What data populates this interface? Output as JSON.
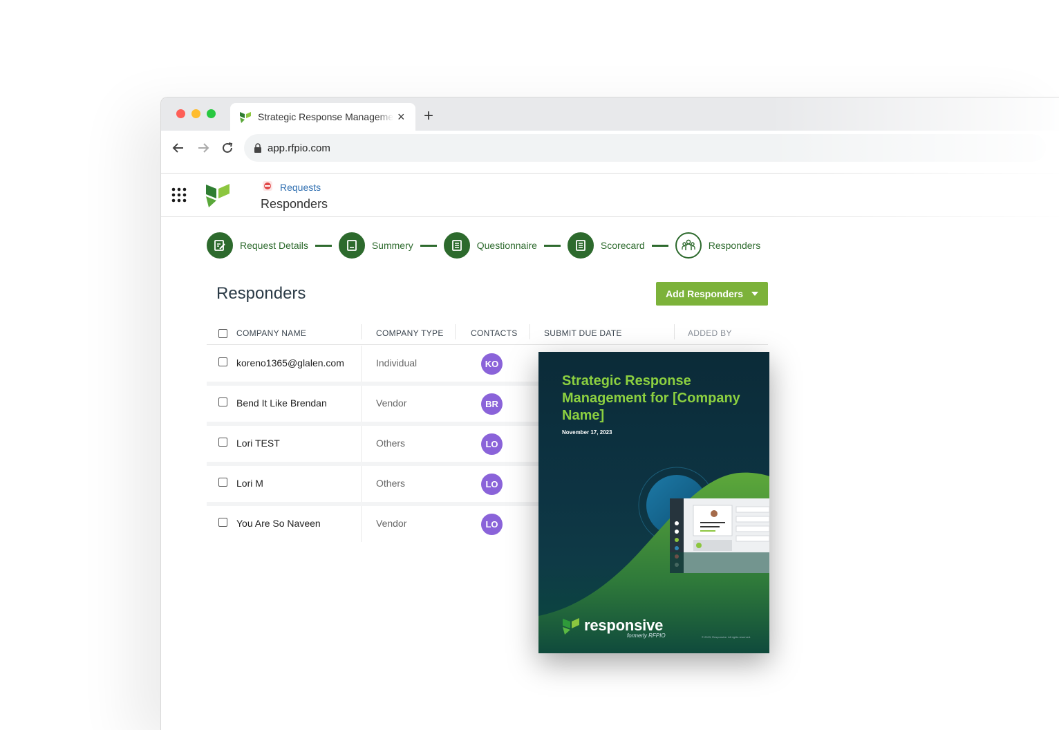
{
  "browser": {
    "tab_title": "Strategic Response Management",
    "tab_close": "×",
    "new_tab": "+",
    "url": "app.rfpio.com"
  },
  "app": {
    "breadcrumb": "Requests",
    "page_title": "Responders"
  },
  "stepper": {
    "steps": [
      {
        "label": "Request Details",
        "icon": "edit-doc-icon"
      },
      {
        "label": "Summery",
        "icon": "doc-icon"
      },
      {
        "label": "Questionnaire",
        "icon": "list-doc-icon"
      },
      {
        "label": "Scorecard",
        "icon": "list-doc-icon"
      },
      {
        "label": "Responders",
        "icon": "people-icon"
      }
    ]
  },
  "responders": {
    "title": "Responders",
    "add_button": "Add Responders",
    "columns": [
      "COMPANY NAME",
      "COMPANY TYPE",
      "CONTACTS",
      "SUBMIT DUE DATE",
      "ADDED BY"
    ],
    "rows": [
      {
        "company": "koreno1365@glalen.com",
        "type": "Individual",
        "contact": "KO"
      },
      {
        "company": "Bend It Like Brendan",
        "type": "Vendor",
        "contact": "BR"
      },
      {
        "company": "Lori TEST",
        "type": "Others",
        "contact": "LO"
      },
      {
        "company": "Lori M",
        "type": "Others",
        "contact": "LO"
      },
      {
        "company": "You Are So Naveen",
        "type": "Vendor",
        "contact": "LO"
      }
    ]
  },
  "book": {
    "title": "Strategic Response Management for [Company Name]",
    "date": "November 17, 2023",
    "brand": "responsive",
    "brand_sub": "formerly RFPIO",
    "legal": "© 2023, Responsive. All rights reserved."
  },
  "colors": {
    "brand_green": "#7cb23a",
    "step_green": "#2d6a2d",
    "avatar_purple": "#8a63d9",
    "book_title_green": "#8cd040"
  }
}
